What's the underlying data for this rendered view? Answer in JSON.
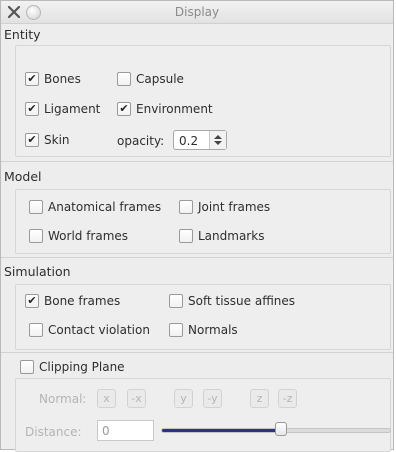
{
  "window": {
    "title": "Display"
  },
  "entity": {
    "label": "Entity",
    "bones": {
      "label": "Bones",
      "checked": true
    },
    "capsule": {
      "label": "Capsule",
      "checked": false
    },
    "ligament": {
      "label": "Ligament",
      "checked": true
    },
    "environment": {
      "label": "Environment",
      "checked": true
    },
    "skin": {
      "label": "Skin",
      "checked": true
    },
    "opacity_label": "opacity:",
    "opacity_value": "0.2"
  },
  "model": {
    "label": "Model",
    "anatomical_frames": {
      "label": "Anatomical frames",
      "checked": false
    },
    "joint_frames": {
      "label": "Joint frames",
      "checked": false
    },
    "world_frames": {
      "label": "World frames",
      "checked": false
    },
    "landmarks": {
      "label": "Landmarks",
      "checked": false
    }
  },
  "simulation": {
    "label": "Simulation",
    "bone_frames": {
      "label": "Bone frames",
      "checked": true
    },
    "soft_tissue_affines": {
      "label": "Soft tissue affines",
      "checked": false
    },
    "contact_violation": {
      "label": "Contact violation",
      "checked": false
    },
    "normals": {
      "label": "Normals",
      "checked": false
    }
  },
  "clipping": {
    "label": "Clipping Plane",
    "checked": false,
    "normal_label": "Normal:",
    "buttons": [
      "x",
      "-x",
      "y",
      "-y",
      "z",
      "-z"
    ],
    "distance_label": "Distance:",
    "distance_value": "0",
    "slider_fraction": 0.52
  }
}
